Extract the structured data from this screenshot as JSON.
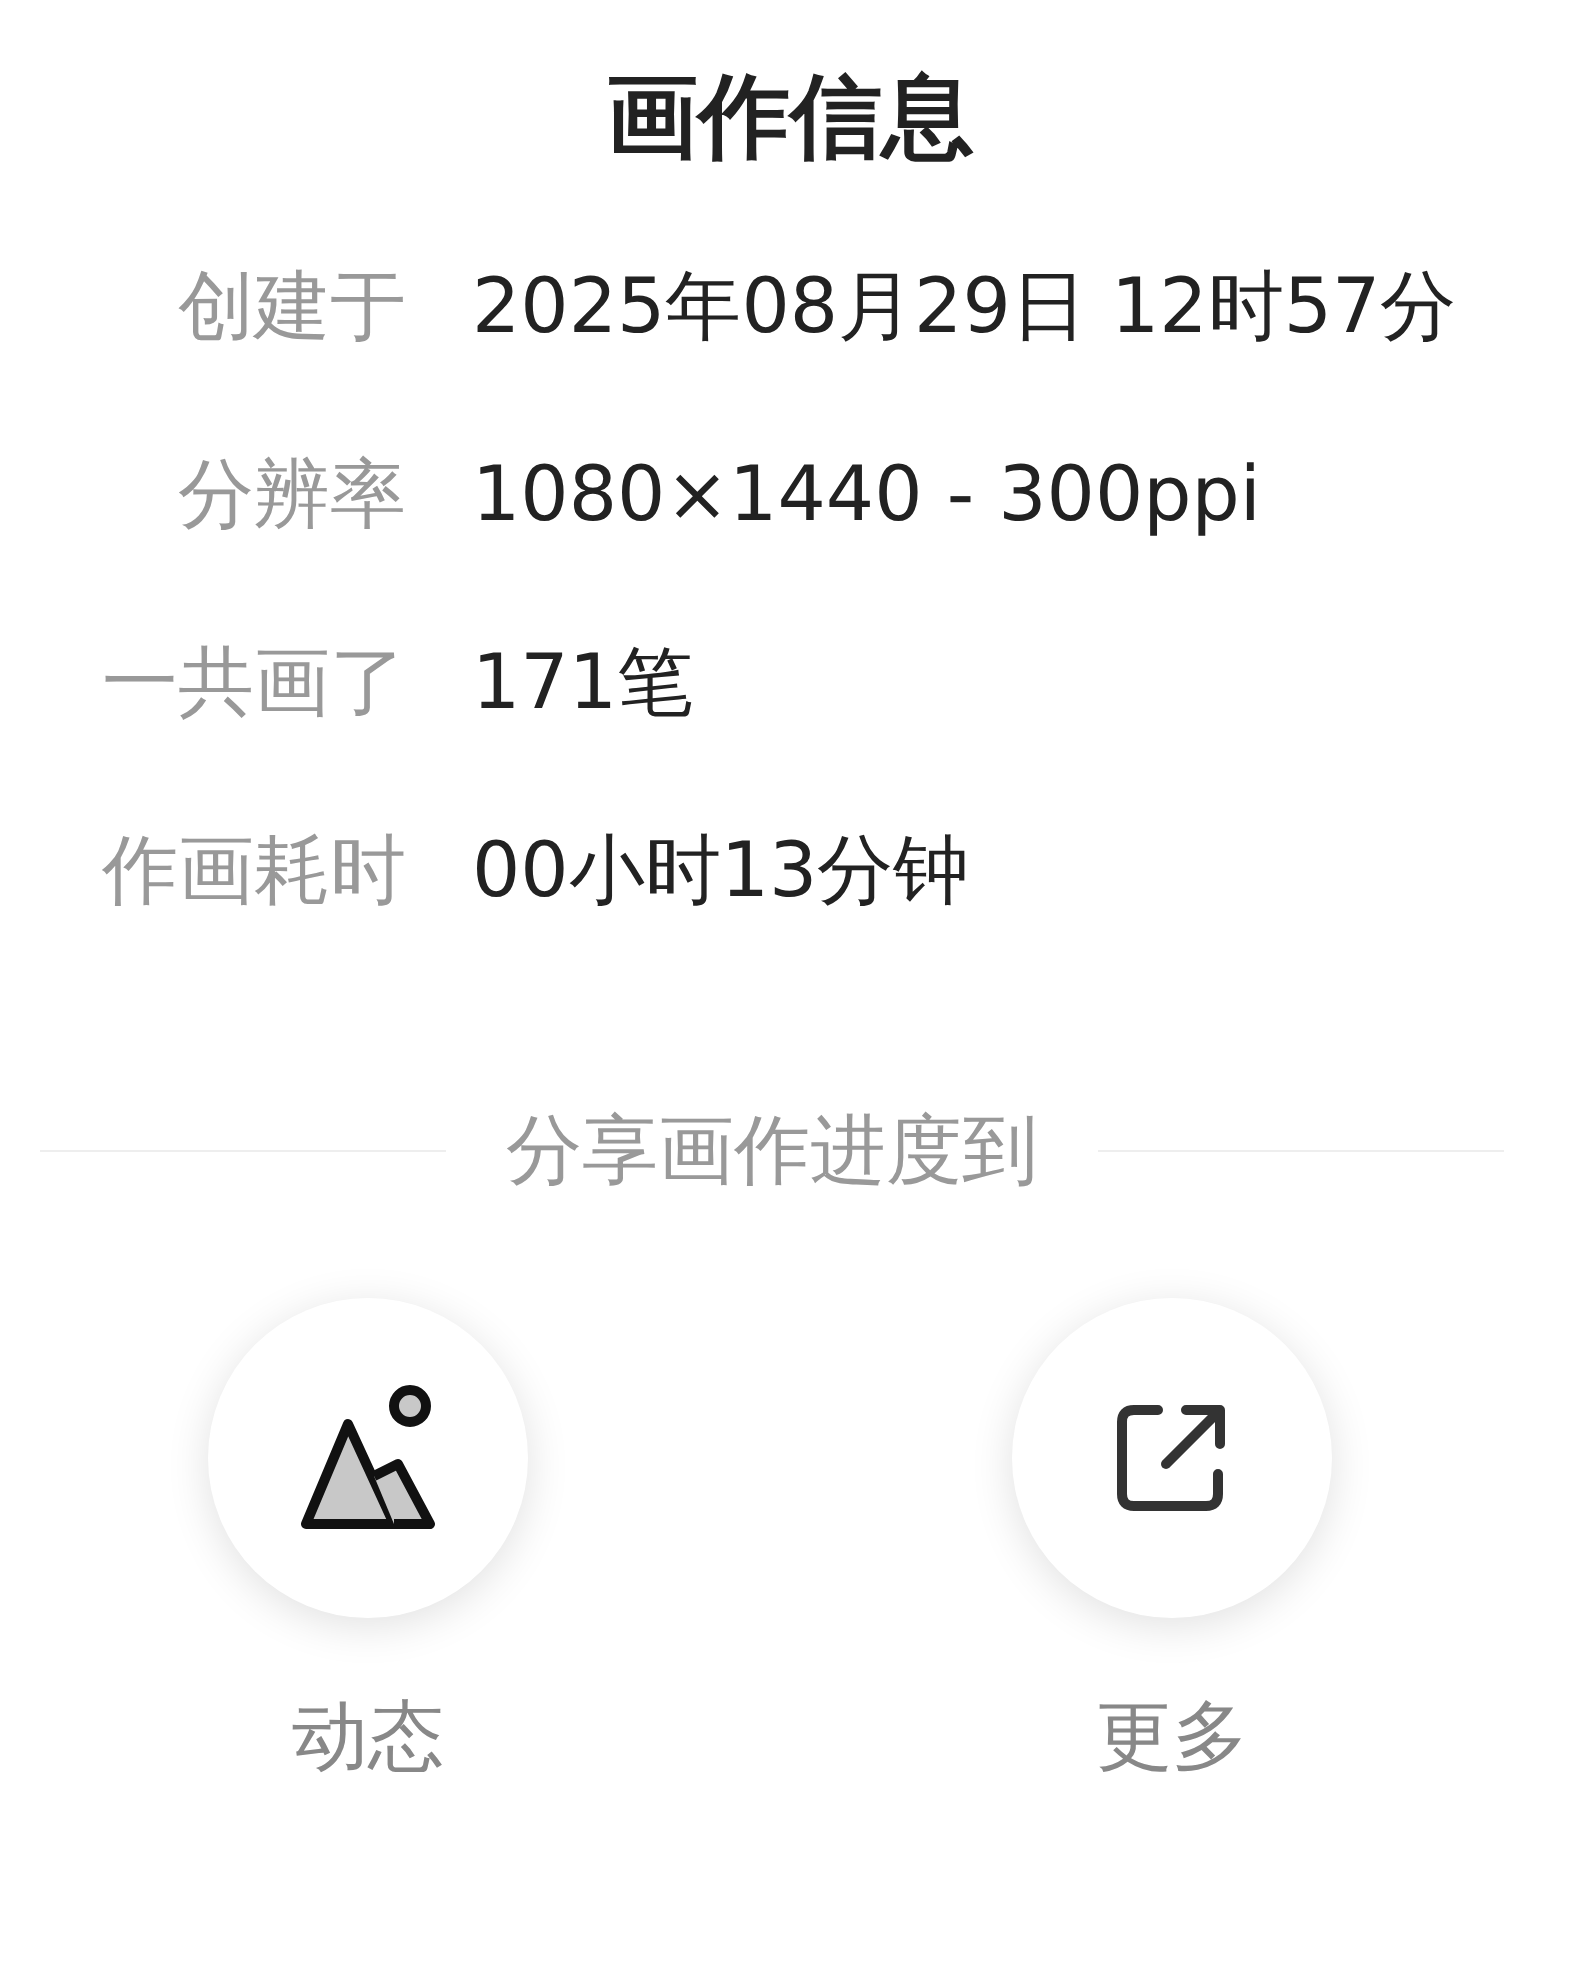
{
  "title": "画作信息",
  "info": [
    {
      "label": "创建于",
      "value": "2025年08月29日 12时57分"
    },
    {
      "label": "分辨率",
      "value": "1080×1440 - 300ppi"
    },
    {
      "label": "一共画了",
      "value": "171笔"
    },
    {
      "label": "作画耗时",
      "value": "00小时13分钟"
    }
  ],
  "share": {
    "heading": "分享画作进度到",
    "targets": [
      {
        "kind": "moments",
        "label": "动态"
      },
      {
        "kind": "more",
        "label": "更多"
      }
    ]
  }
}
